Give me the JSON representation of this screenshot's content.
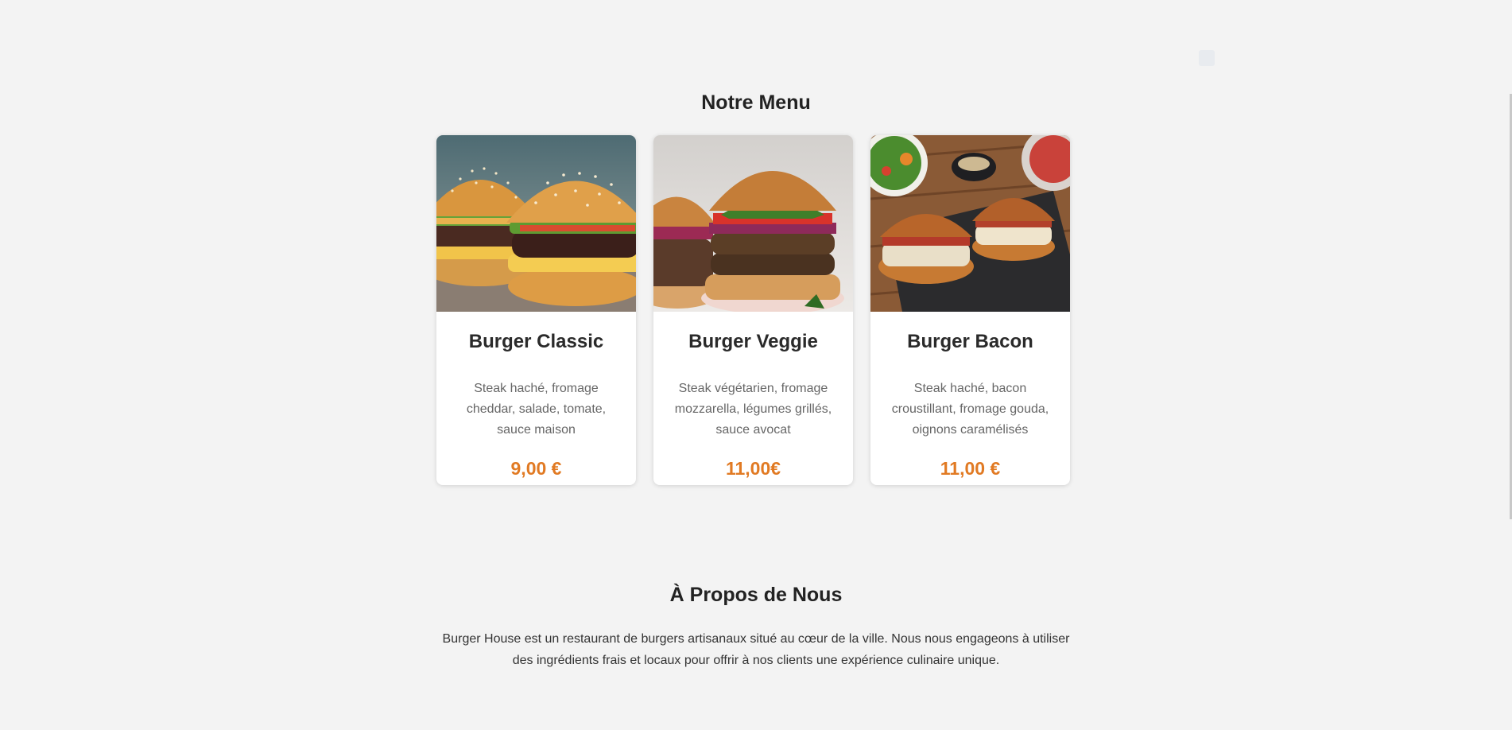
{
  "menu": {
    "title": "Notre Menu",
    "items": [
      {
        "name": "Burger Classic",
        "description": "Steak haché, fromage cheddar, salade, tomate, sauce maison",
        "price": "9,00 €",
        "image_icon": "classic-burger-photo"
      },
      {
        "name": "Burger Veggie",
        "description": "Steak végétarien, fromage mozzarella, légumes grillés, sauce avocat",
        "price": "11,00€",
        "image_icon": "veggie-burger-photo"
      },
      {
        "name": "Burger Bacon",
        "description": "Steak haché, bacon croustillant, fromage gouda, oignons caramélisés",
        "price": "11,00 €",
        "image_icon": "bacon-burger-photo"
      }
    ]
  },
  "about": {
    "title": "À Propos de Nous",
    "text": "Burger House est un restaurant de burgers artisanaux situé au cœur de la ville. Nous nous engageons à utiliser des ingrédients frais et locaux pour offrir à nos clients une expérience culinaire unique."
  },
  "colors": {
    "background": "#f3f3f3",
    "accent_price": "#e17a23",
    "card": "#ffffff"
  }
}
